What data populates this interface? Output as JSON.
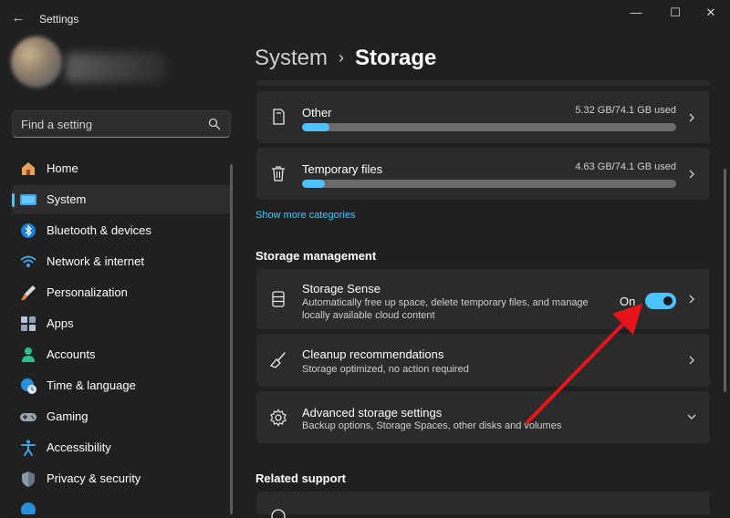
{
  "window": {
    "title": "Settings",
    "controls": {
      "minimize": "—",
      "maximize": "☐",
      "close": "✕"
    }
  },
  "search": {
    "placeholder": "Find a setting"
  },
  "sidebar": {
    "items": [
      {
        "label": "Home",
        "icon": "home-icon",
        "selected": false
      },
      {
        "label": "System",
        "icon": "system-icon",
        "selected": true
      },
      {
        "label": "Bluetooth & devices",
        "icon": "bluetooth-icon",
        "selected": false
      },
      {
        "label": "Network & internet",
        "icon": "wifi-icon",
        "selected": false
      },
      {
        "label": "Personalization",
        "icon": "brush-icon",
        "selected": false
      },
      {
        "label": "Apps",
        "icon": "apps-icon",
        "selected": false
      },
      {
        "label": "Accounts",
        "icon": "accounts-icon",
        "selected": false
      },
      {
        "label": "Time & language",
        "icon": "globe-clock-icon",
        "selected": false
      },
      {
        "label": "Gaming",
        "icon": "gamepad-icon",
        "selected": false
      },
      {
        "label": "Accessibility",
        "icon": "accessibility-icon",
        "selected": false
      },
      {
        "label": "Privacy & security",
        "icon": "shield-icon",
        "selected": false
      }
    ]
  },
  "breadcrumb": {
    "parent": "System",
    "separator": "›",
    "current": "Storage"
  },
  "categories": [
    {
      "name": "Other",
      "used": "5.32 GB/74.1 GB used",
      "fraction": 0.072,
      "icon": "document-icon"
    },
    {
      "name": "Temporary files",
      "used": "4.63 GB/74.1 GB used",
      "fraction": 0.062,
      "icon": "trash-icon"
    }
  ],
  "show_more": "Show more categories",
  "storage_management": {
    "heading": "Storage management",
    "storage_sense": {
      "title": "Storage Sense",
      "description": "Automatically free up space, delete temporary files, and manage locally available cloud content",
      "toggle_label": "On",
      "enabled": true
    },
    "cleanup": {
      "title": "Cleanup recommendations",
      "description": "Storage optimized, no action required"
    },
    "advanced": {
      "title": "Advanced storage settings",
      "description": "Backup options, Storage Spaces, other disks and volumes"
    }
  },
  "related_support": {
    "heading": "Related support"
  },
  "colors": {
    "accent": "#4cc2ff",
    "annotation_arrow": "#e8141b",
    "background": "#202020",
    "card": "#2b2b2b"
  }
}
